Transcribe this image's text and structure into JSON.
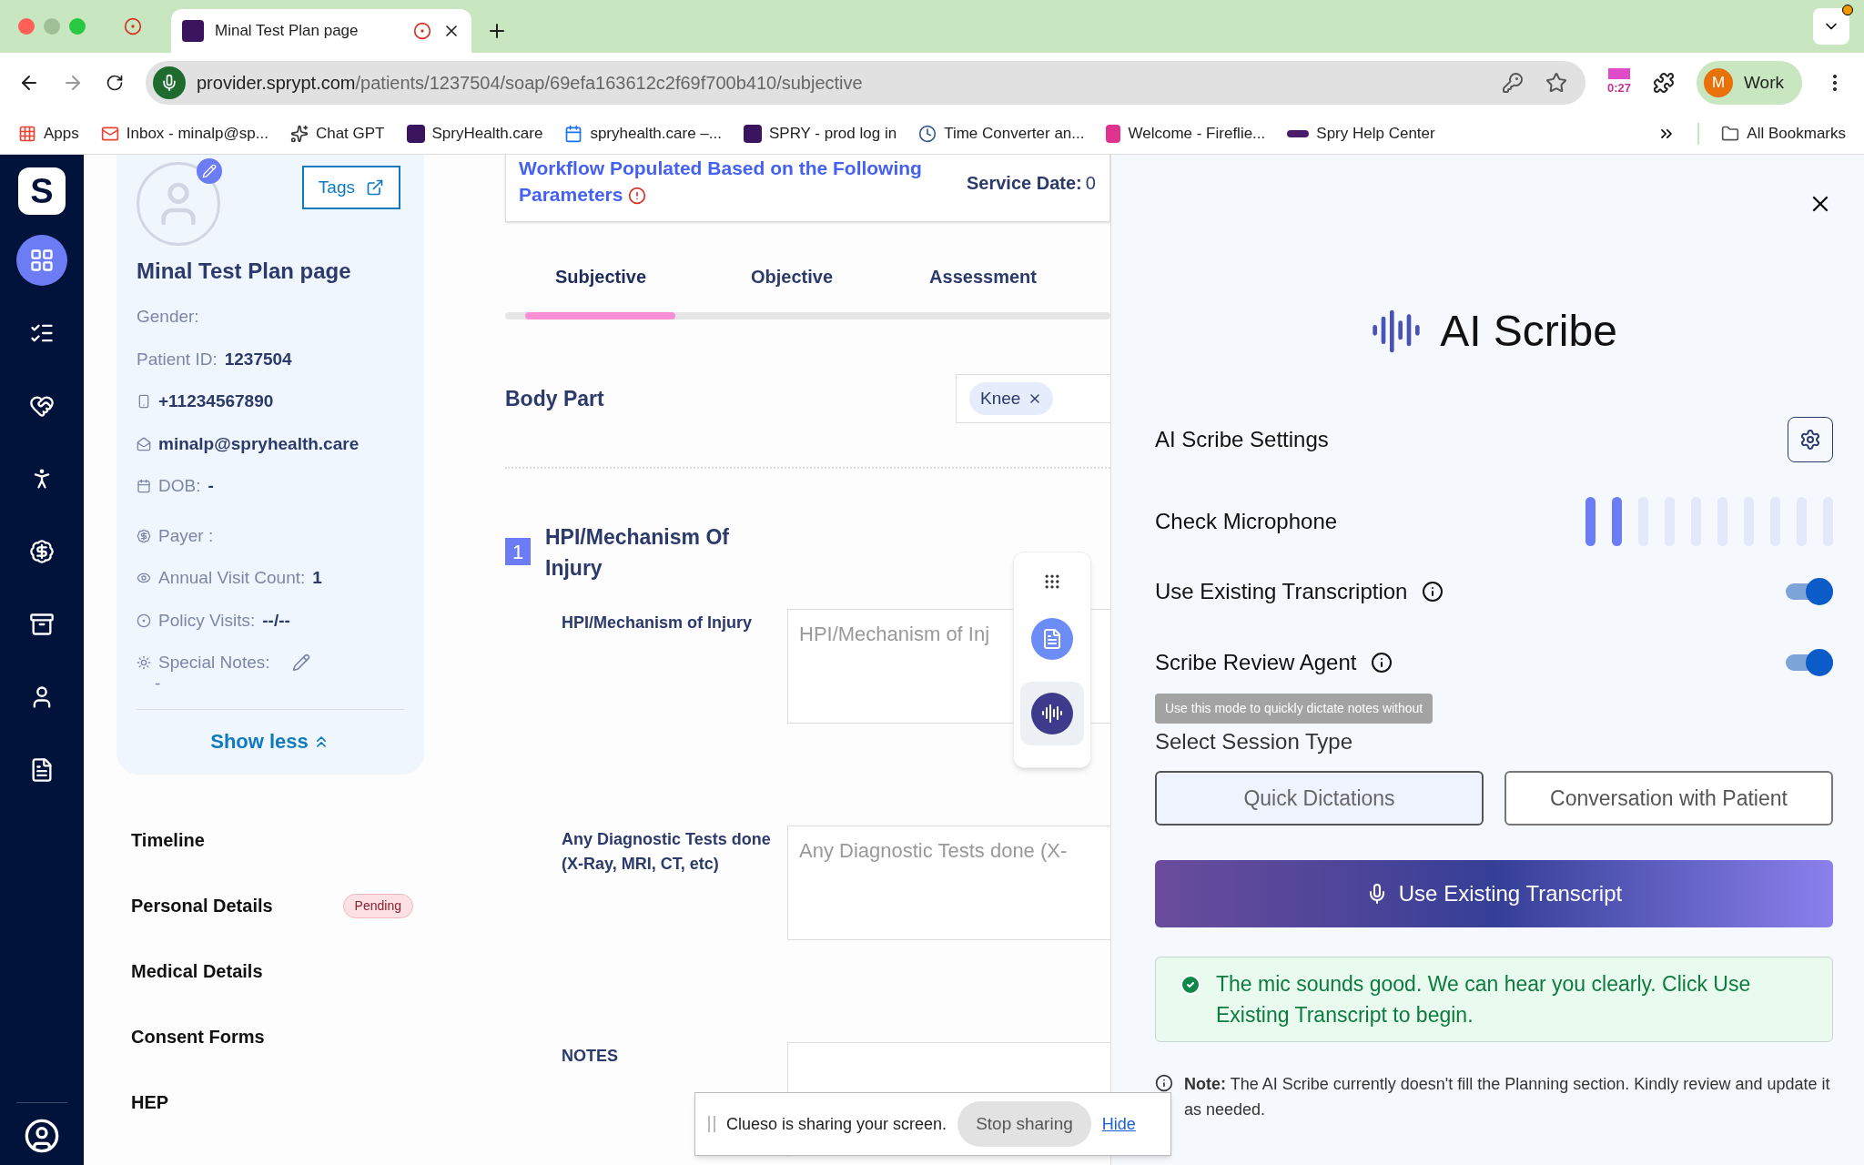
{
  "browser": {
    "tab": {
      "title": "Minal Test Plan page"
    },
    "url_host": "provider.sprypt.com",
    "url_path": "/patients/1237504/soap/69efa163612c2f69f700b410/subjective",
    "timer": "0:27",
    "profile_initial": "M",
    "profile_name": "Work",
    "bookmarks": [
      "Apps",
      "Inbox - minalp@sp...",
      "Chat GPT",
      "SpryHealth.care",
      "spryhealth.care –...",
      "SPRY - prod log in",
      "Time Converter an...",
      "Welcome - Fireflie...",
      "Spry Help Center"
    ],
    "all_bookmarks": "All Bookmarks"
  },
  "sidebar": {
    "logo": "S",
    "items": [
      {
        "selected": true
      },
      {
        "selected": false
      },
      {
        "selected": false
      },
      {
        "selected": false
      },
      {
        "selected": false
      },
      {
        "selected": false
      },
      {
        "selected": false
      },
      {
        "selected": false
      }
    ]
  },
  "patient": {
    "tags": "Tags",
    "name": "Minal Test Plan page",
    "gender_label": "Gender:",
    "id_label": "Patient ID:",
    "id": "1237504",
    "phone": "+11234567890",
    "email": "minalp@spryhealth.care",
    "dob_label": "DOB:",
    "dob": "-",
    "payer_label": "Payer :",
    "visit_count_label": "Annual Visit Count:",
    "visit_count": "1",
    "policy_label": "Policy Visits:",
    "policy": "--/--",
    "notes_label": "Special Notes:",
    "notes": "-",
    "show_less": "Show less"
  },
  "nav": [
    {
      "label": "Timeline"
    },
    {
      "label": "Personal Details",
      "badge": "Pending"
    },
    {
      "label": "Medical Details"
    },
    {
      "label": "Consent Forms"
    },
    {
      "label": "HEP"
    }
  ],
  "workflow": {
    "title": "Workflow Populated Based on the Following Parameters",
    "service_date_label": "Service Date:",
    "service_date": "0"
  },
  "soap_tabs": [
    {
      "label": "Subjective",
      "selected": true
    },
    {
      "label": "Objective",
      "selected": false
    },
    {
      "label": "Assessment",
      "selected": false
    }
  ],
  "body_part": {
    "label": "Body Part",
    "chips": [
      "Knee"
    ]
  },
  "section": {
    "number": "1",
    "title": "HPI/Mechanism Of Injury",
    "fields": [
      {
        "label": "HPI/Mechanism of Injury",
        "placeholder": "HPI/Mechanism of Inj"
      },
      {
        "label": "Any Diagnostic Tests done (X-Ray, MRI, CT, etc)",
        "placeholder": "Any Diagnostic Tests done (X-"
      },
      {
        "label": "NOTES"
      }
    ]
  },
  "float_toolbar": [
    {
      "selected": false
    },
    {
      "selected": true
    }
  ],
  "scribe": {
    "title": "AI Scribe",
    "settings_label": "AI Scribe Settings",
    "mic_label": "Check Microphone",
    "mic_level": {
      "level": 0.2
    },
    "toggles": [
      {
        "label": "Use Existing Transcription",
        "on": true
      },
      {
        "label": "Scribe Review Agent",
        "on": true
      }
    ],
    "tooltip": "Use this mode to quickly dictate notes without",
    "session_label": "Select Session Type",
    "sessions": [
      {
        "label": "Quick Dictations",
        "selected": true
      },
      {
        "label": "Conversation with Patient",
        "selected": false
      }
    ],
    "start_button": "Use Existing Transcript",
    "success": "The mic sounds good. We can hear you clearly. Click Use Existing Transcript to begin.",
    "note": "**Note:** The AI Scribe currently doesn't fill the Planning section. Kindly review and update it as needed."
  },
  "screen_share": {
    "message": "Clueso is sharing your screen.",
    "stop": "Stop sharing",
    "hide": "Hide"
  }
}
